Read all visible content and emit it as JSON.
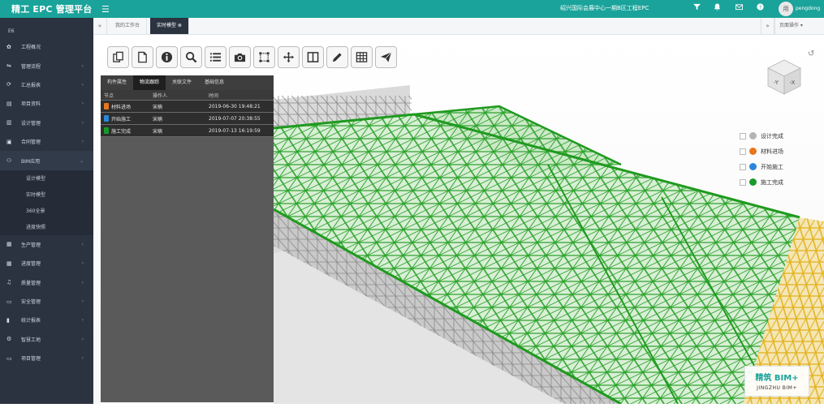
{
  "header": {
    "brand": "精工 EPC 管理平台",
    "menu_icon": "hamburger-icon",
    "project": "绍兴国际会展中心一期B区工程EPC",
    "icons": [
      "filter-icon",
      "bell-icon",
      "mail-icon",
      "help-icon"
    ],
    "avatar_text": "用",
    "username": "pengdong",
    "accent": "#1aa39a"
  },
  "sidebar": {
    "heading": "E6",
    "items": [
      {
        "label": "工程概况",
        "icon": "settings-icon"
      },
      {
        "label": "管理流程",
        "icon": "flow-icon"
      },
      {
        "label": "汇总报表",
        "icon": "refresh-icon"
      },
      {
        "label": "项目资料",
        "icon": "files-icon"
      },
      {
        "label": "设计管理",
        "icon": "book-icon"
      },
      {
        "label": "合同管理",
        "icon": "briefcase-icon"
      },
      {
        "label": "BIM应用",
        "icon": "cluster-icon"
      }
    ],
    "sub_items": [
      "设计模型",
      "实时模型",
      "360全景",
      "进度快照"
    ],
    "items_after": [
      {
        "label": "生产管理",
        "icon": "building-icon"
      },
      {
        "label": "进度管理",
        "icon": "building-icon"
      },
      {
        "label": "质量管理",
        "icon": "bell-outline-icon"
      },
      {
        "label": "安全管理",
        "icon": "monitor-icon"
      },
      {
        "label": "统计报表",
        "icon": "bar-chart-icon"
      },
      {
        "label": "智慧工地",
        "icon": "cogs-icon"
      },
      {
        "label": "项目管理",
        "icon": "monitor-icon"
      }
    ]
  },
  "tabs": {
    "back_icon": "double-left-icon",
    "items": [
      {
        "label": "我的工作台"
      },
      {
        "label": "实时模型 ⊗"
      }
    ],
    "forward_icon": "double-right-icon",
    "page_ops": "页面操作 ▾"
  },
  "toolbar": {
    "tools": [
      "copy-icon",
      "document-icon",
      "info-icon",
      "search-icon",
      "list-icon",
      "camera-icon",
      "section-box-icon",
      "move-icon",
      "split-view-icon",
      "pencil-icon",
      "grid-icon",
      "send-icon"
    ]
  },
  "panel": {
    "tabs": [
      "构件属性",
      "物流跟踪",
      "关联文件",
      "基础信息"
    ],
    "headers": [
      "节点",
      "操作人",
      "时间"
    ],
    "rows": [
      {
        "node": "材料进场",
        "color": "#e8761e",
        "operator": "宋楠",
        "time": "2019-06-30 19:48:21"
      },
      {
        "node": "开始施工",
        "color": "#2b86d9",
        "operator": "宋楠",
        "time": "2019-07-07 20:38:55"
      },
      {
        "node": "施工完成",
        "color": "#1a9a2a",
        "operator": "宋楠",
        "time": "2019-07-13 16:19:59"
      }
    ]
  },
  "viewcube": {
    "left": "-Y",
    "right": "-X",
    "reset_icon": "reset-icon"
  },
  "legend": [
    {
      "label": "设计完成",
      "color": "#b5b5b5"
    },
    {
      "label": "材料进场",
      "color": "#e8761e"
    },
    {
      "label": "开始施工",
      "color": "#2b86d9"
    },
    {
      "label": "施工完成",
      "color": "#1a9a2a"
    }
  ],
  "logo": {
    "line1": "精筑 BIM+",
    "line2": "JINGZHU BIM+"
  }
}
